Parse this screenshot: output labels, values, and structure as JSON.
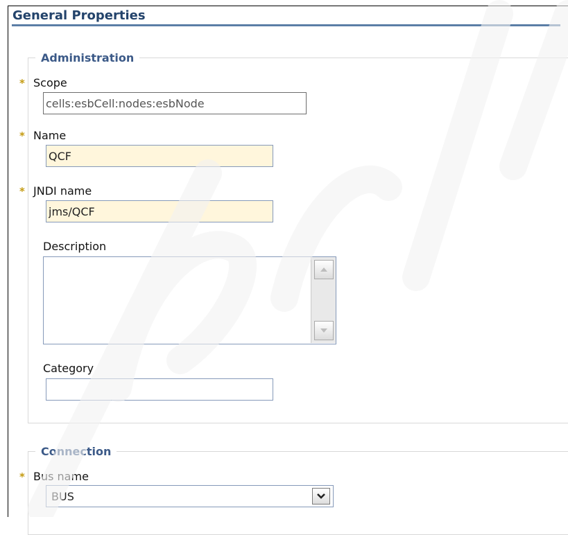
{
  "page": {
    "section_title": "General Properties"
  },
  "administration": {
    "legend": "Administration",
    "scope": {
      "label": "Scope",
      "value": "cells:esbCell:nodes:esbNode"
    },
    "name": {
      "label": "Name",
      "value": "QCF"
    },
    "jndi_name": {
      "label": "JNDI name",
      "value": "jms/QCF"
    },
    "description": {
      "label": "Description",
      "value": ""
    },
    "category": {
      "label": "Category",
      "value": ""
    }
  },
  "connection": {
    "legend": "Connection",
    "bus_name": {
      "label": "Bus name",
      "selected": "BUS"
    }
  },
  "required_marker": "*",
  "colors": {
    "section_title": "#23436b",
    "legend": "#3c5a88",
    "required_marker": "#c49b12",
    "required_field_bg": "#fff6dc",
    "input_border": "#8599b9"
  },
  "icons": {
    "scroll_up": "triangle-up-icon",
    "scroll_down": "triangle-down-icon",
    "dropdown": "chevron-down-icon"
  }
}
